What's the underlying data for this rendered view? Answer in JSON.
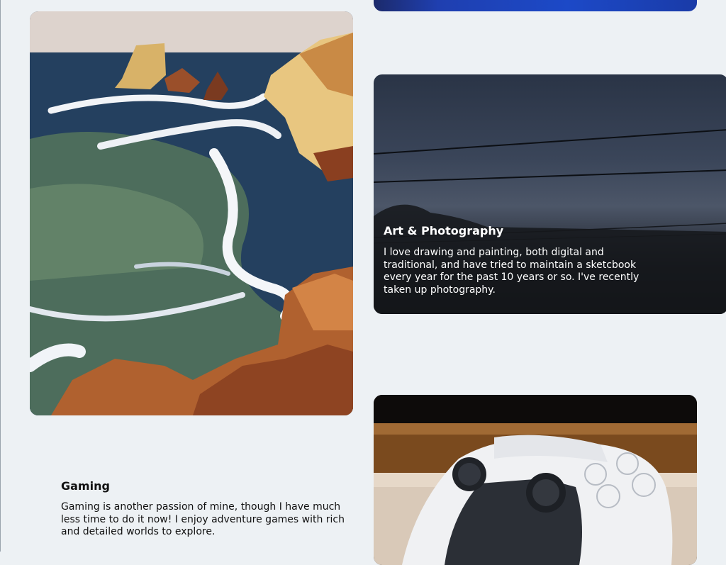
{
  "art": {
    "title": "Art & Photography",
    "body": "I love drawing and painting, both digital and traditional, and have tried to maintain a sketcbook every year for the past 10 years or so. I've recently taken up photography."
  },
  "gaming": {
    "title": "Gaming",
    "body": "Gaming is another passion of mine, though I have much less time to do it now! I enjoy adventure games with rich and detailed worlds to explore."
  },
  "colors": {
    "background": "#edf1f4",
    "text": "#111111",
    "overlay_text": "#ffffff"
  }
}
